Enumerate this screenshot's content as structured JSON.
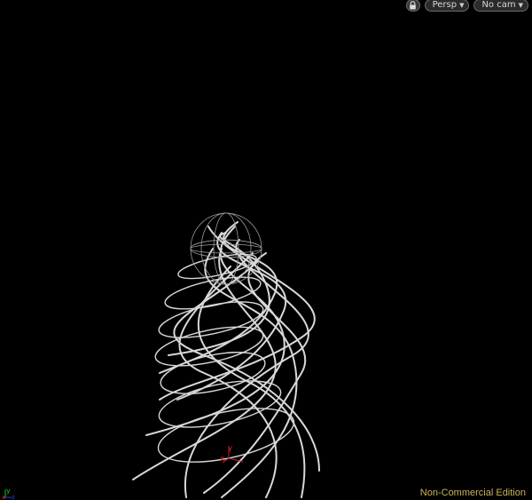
{
  "viewport": {
    "view_menu_label": "Persp",
    "camera_menu_label": "No cam",
    "watermark": "Non-Commercial Edition",
    "lock_icon": "lock-icon",
    "colors": {
      "background": "#000000",
      "curves": "#d8d8d8",
      "sphere_wire": "#9a9a9a",
      "watermark": "#c9b25a",
      "axis_x": "#cc2020",
      "axis_y": "#20c020",
      "axis_z": "#2040e0"
    }
  },
  "gnomon": {
    "x_label": "x",
    "y_label": "y",
    "z_label": "z"
  },
  "corner_gnomon": {
    "x_label": "x",
    "y_label": "y",
    "z_label": "z"
  }
}
